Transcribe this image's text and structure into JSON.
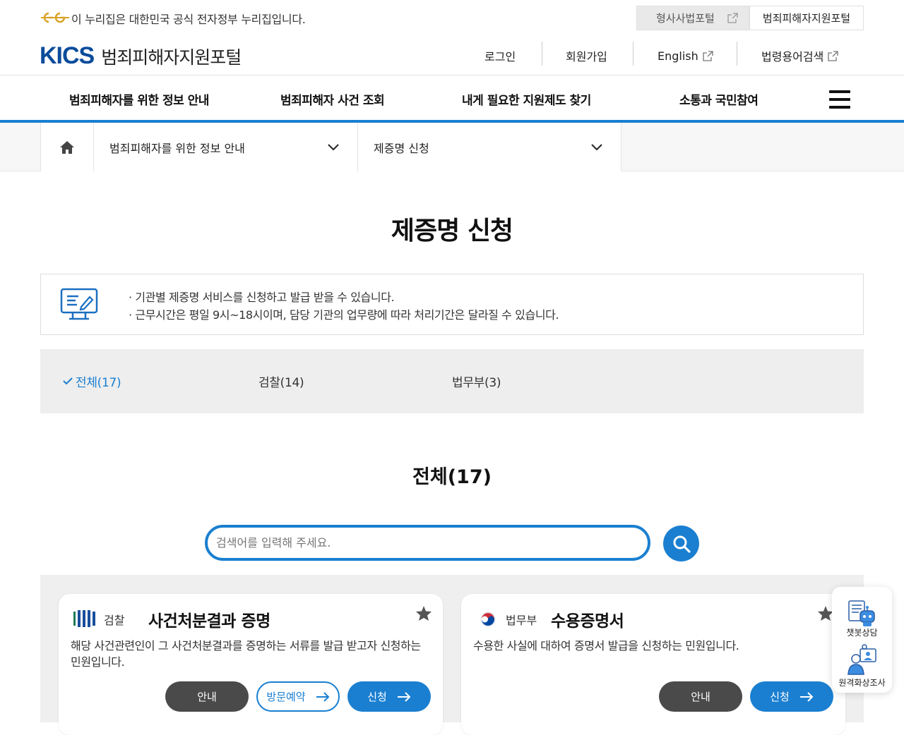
{
  "gov_banner": {
    "text": "이 누리집은 대한민국 공식 전자정부 누리집입니다.",
    "portal_links": [
      "형사사법포털",
      "범죄피해자지원포털"
    ]
  },
  "header": {
    "logo_text": "KICS",
    "portal_name": "범죄피해자지원포털",
    "util_links": [
      "로그인",
      "회원가입",
      "English",
      "법령용어검색"
    ]
  },
  "gnb": {
    "items": [
      "범죄피해자를 위한 정보 안내",
      "범죄피해자 사건 조회",
      "내게 필요한 지원제도 찾기",
      "소통과 국민참여"
    ]
  },
  "breadcrumb": {
    "level1": "범죄피해자를 위한 정보 안내",
    "level2": "제증명 신청"
  },
  "page": {
    "title": "제증명 신청",
    "info": [
      "· 기관별 제증명 서비스를 신청하고 발급 받을 수 있습니다.",
      "· 근무시간은 평일 9시~18시이며, 담당 기관의 업무량에 따라 처리기간은 달라질 수 있습니다."
    ]
  },
  "tabs": [
    "전체(17)",
    "검찰(14)",
    "법무부(3)"
  ],
  "section": {
    "title": "전체(17)",
    "search_placeholder": "검색어를 입력해 주세요."
  },
  "cards": [
    {
      "agency": "검찰",
      "title": "사건처분결과 증명",
      "desc": "해당 사건관련인이 그 사건처분결과를 증명하는 서류를 발급 받고자 신청하는 민원입니다.",
      "buttons": [
        "안내",
        "방문예약",
        "신청"
      ]
    },
    {
      "agency": "법무부",
      "title": "수용증명서",
      "desc": "수용한 사실에 대하여 증명서 발급을 신청하는 민원입니다.",
      "buttons": [
        "안내",
        "신청"
      ]
    }
  ],
  "floating": {
    "chatbot": "챗봇상담",
    "video": "원격화상조사"
  },
  "colors": {
    "accent": "#1a7fd0",
    "dark_button": "#4a4a4a",
    "logo": "#0a4c9b"
  }
}
